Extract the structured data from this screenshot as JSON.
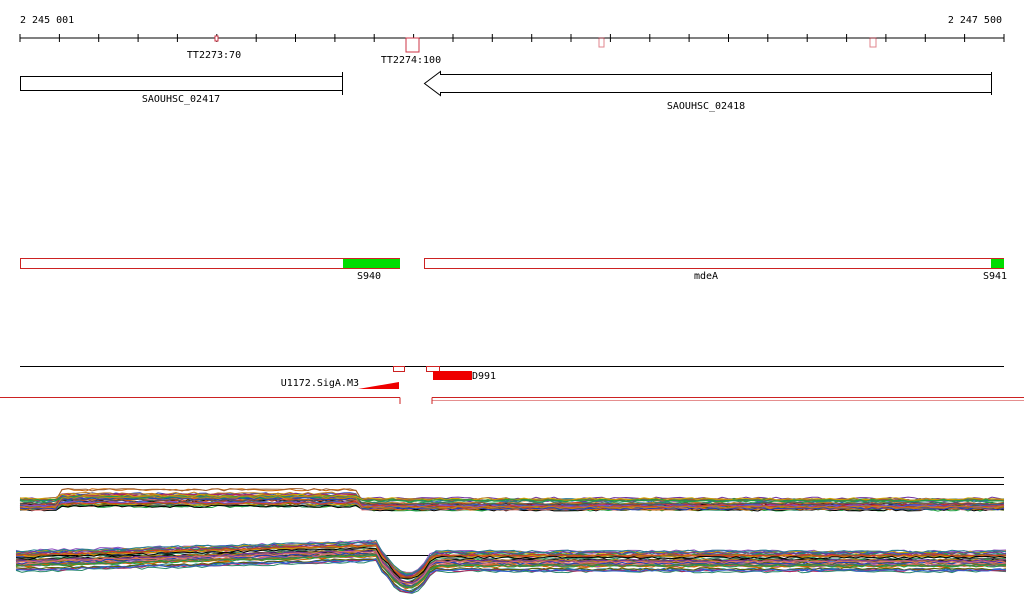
{
  "coords": {
    "start": "2 245 001",
    "end": "2 247 500"
  },
  "terminators": [
    {
      "label": "TT2273:70"
    },
    {
      "label": "TT2274:100"
    }
  ],
  "genes": [
    {
      "label": "SAOUHSC_02417",
      "strand": "+"
    },
    {
      "label": "SAOUHSC_02418",
      "strand": "-"
    }
  ],
  "transcripts": [
    {
      "label": "S940"
    },
    {
      "label": "mdeA"
    },
    {
      "label": "S941"
    }
  ],
  "features": [
    {
      "label": "U1172.SigA.M3"
    },
    {
      "label": "D991"
    }
  ],
  "colors": {
    "axis": "#000000",
    "terminator": "#cc3344",
    "transcript_outline": "#cc2222",
    "utr_fill": "#00dd00",
    "feature_fill": "#ee0000"
  }
}
